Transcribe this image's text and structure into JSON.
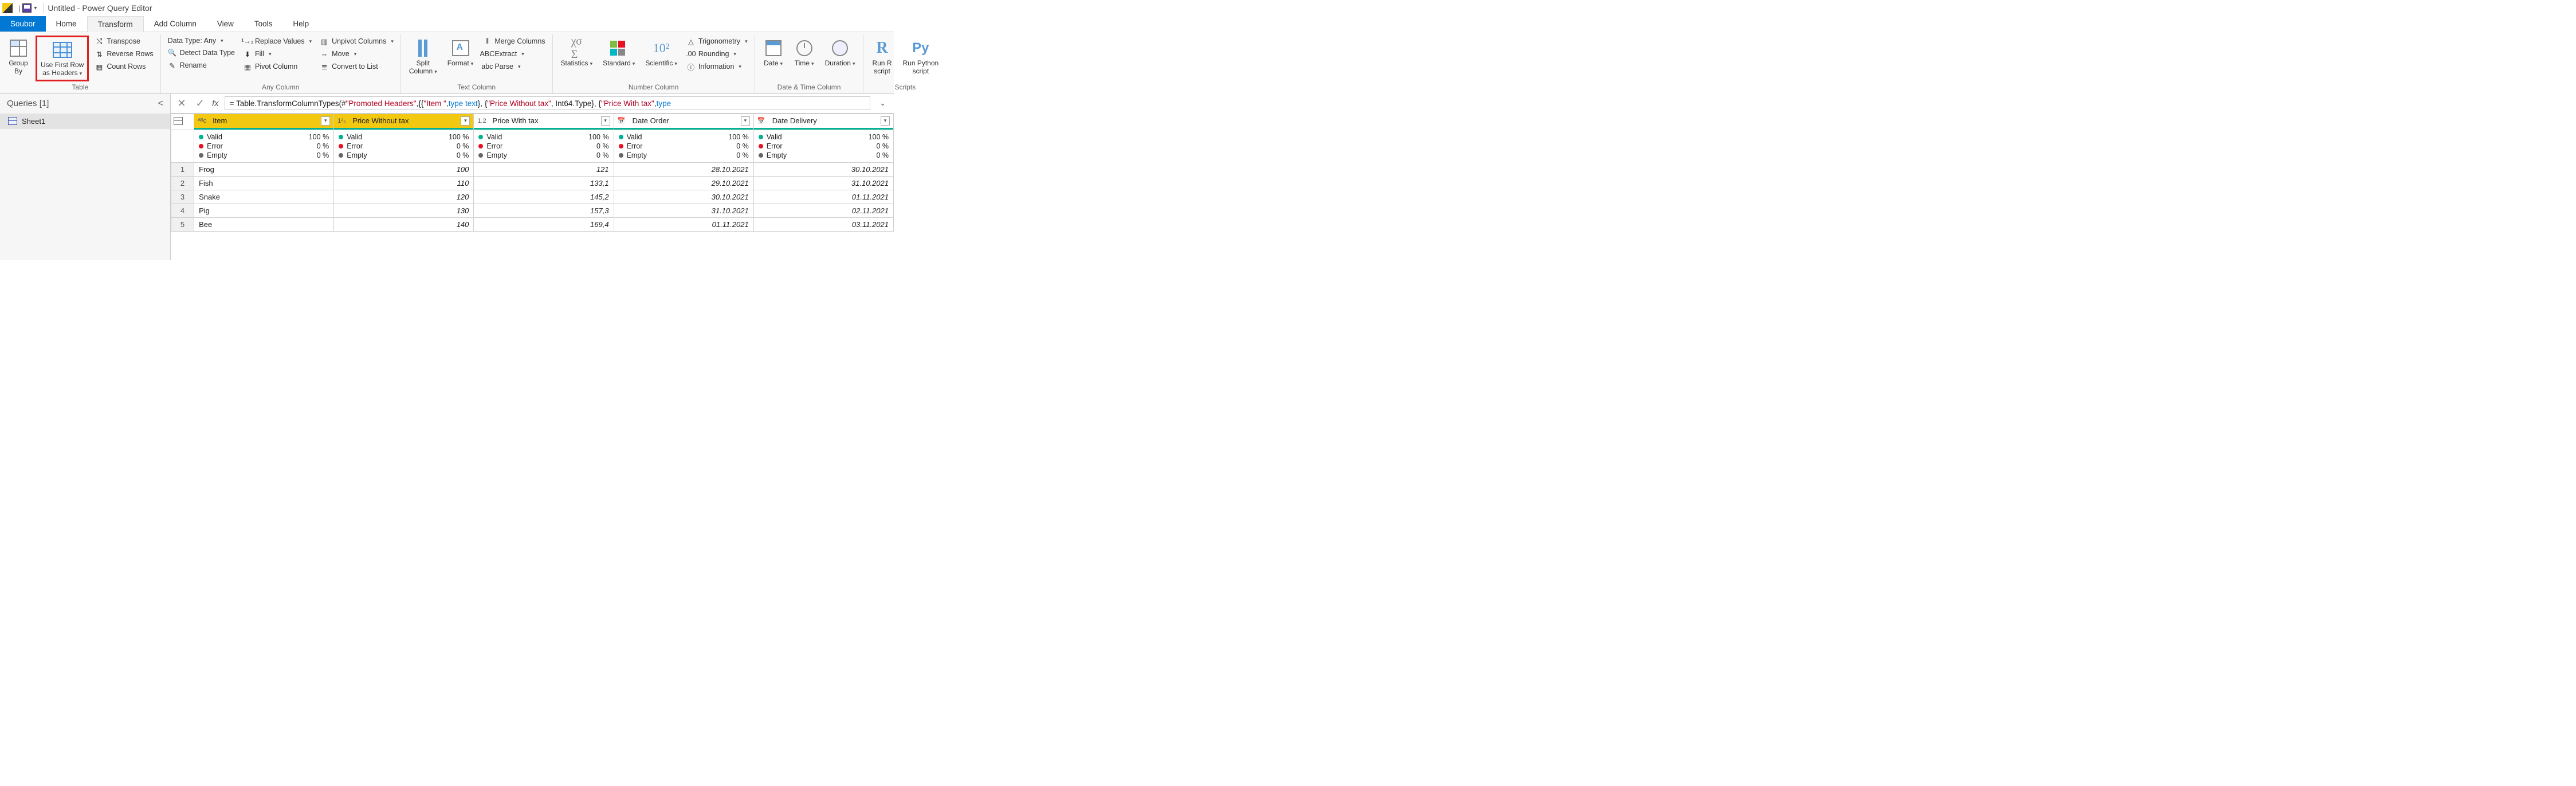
{
  "titlebar": {
    "title": "Untitled - Power Query Editor"
  },
  "menu": {
    "file": "Soubor",
    "home": "Home",
    "transform": "Transform",
    "addcolumn": "Add Column",
    "view": "View",
    "tools": "Tools",
    "help": "Help"
  },
  "ribbon": {
    "table": {
      "label": "Table",
      "groupby": "Group\nBy",
      "usefirst": "Use First Row\nas Headers",
      "transpose": "Transpose",
      "reverse": "Reverse Rows",
      "count": "Count Rows"
    },
    "anycol": {
      "label": "Any Column",
      "datatype": "Data Type: Any",
      "detect": "Detect Data Type",
      "rename": "Rename",
      "replace": "Replace Values",
      "fill": "Fill",
      "pivot": "Pivot Column",
      "unpivot": "Unpivot Columns",
      "move": "Move",
      "tolist": "Convert to List"
    },
    "textcol": {
      "label": "Text Column",
      "split": "Split\nColumn",
      "format": "Format",
      "merge": "Merge Columns",
      "extract": "Extract",
      "parse": "Parse"
    },
    "numcol": {
      "label": "Number Column",
      "stats": "Statistics",
      "standard": "Standard",
      "sci": "Scientific",
      "trig": "Trigonometry",
      "round": "Rounding",
      "info": "Information"
    },
    "datecol": {
      "label": "Date & Time Column",
      "date": "Date",
      "time": "Time",
      "duration": "Duration"
    },
    "scripts": {
      "label": "Scripts",
      "r": "Run R\nscript",
      "py": "Run Python\nscript"
    }
  },
  "queries": {
    "header": "Queries [1]",
    "item1": "Sheet1"
  },
  "formula": {
    "prefix": "= Table.TransformColumnTypes(#",
    "s1": "\"Promoted Headers\"",
    "mid1": ",{{",
    "s2": "\"Item \"",
    "mid2": ", ",
    "kw1": "type text",
    "mid3": "}, {",
    "s3": "\"Price Without tax\"",
    "mid4": ", Int64.Type}, {",
    "s4": "\"Price With tax\"",
    "mid5": ", ",
    "kw2": "type"
  },
  "columns": {
    "c1": {
      "type": "ᴬᴮc",
      "name": "Item"
    },
    "c2": {
      "type": "1²₃",
      "name": "Price Without tax"
    },
    "c3": {
      "type": "1.2",
      "name": "Price With tax"
    },
    "c4": {
      "type": "📅",
      "name": "Date Order"
    },
    "c5": {
      "type": "📅",
      "name": "Date Delivery"
    }
  },
  "quality": {
    "valid": "Valid",
    "error": "Error",
    "empty": "Empty",
    "v100": "100 %",
    "v0": "0 %"
  },
  "rows": [
    {
      "n": "1",
      "item": "Frog",
      "pwt": "100",
      "pwtax": "121",
      "dord": "28.10.2021",
      "ddel": "30.10.2021"
    },
    {
      "n": "2",
      "item": "Fish",
      "pwt": "110",
      "pwtax": "133,1",
      "dord": "29.10.2021",
      "ddel": "31.10.2021"
    },
    {
      "n": "3",
      "item": "Snake",
      "pwt": "120",
      "pwtax": "145,2",
      "dord": "30.10.2021",
      "ddel": "01.11.2021"
    },
    {
      "n": "4",
      "item": "Pig",
      "pwt": "130",
      "pwtax": "157,3",
      "dord": "31.10.2021",
      "ddel": "02.11.2021"
    },
    {
      "n": "5",
      "item": "Bee",
      "pwt": "140",
      "pwtax": "169,4",
      "dord": "01.11.2021",
      "ddel": "03.11.2021"
    }
  ]
}
